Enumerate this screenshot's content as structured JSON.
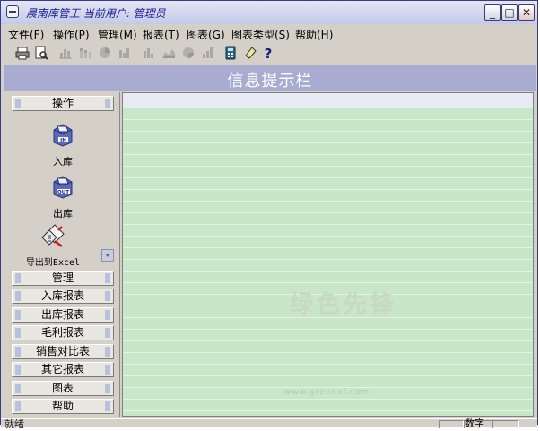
{
  "window": {
    "title": "晨南库管王  当前用户: 管理员",
    "minimize_glyph": "_",
    "maximize_glyph": "□",
    "close_glyph": "✕"
  },
  "menu": [
    "文件(F)",
    "操作(P)",
    "管理(M)",
    "报表(T)",
    "图表(G)",
    "图表类型(S)",
    "帮助(H)"
  ],
  "toolbar": {
    "icons": [
      "print-icon",
      "print-preview-icon",
      "bar-chart-icon",
      "stacked-chart-icon",
      "pie-chart-icon",
      "bar-chart-2-icon",
      "bar-chart-3-icon",
      "area-chart-icon",
      "pie-chart-2-icon",
      "bar-chart-4-icon",
      "calculator-icon",
      "eraser-icon",
      "help-icon"
    ]
  },
  "info_bar": {
    "label": "信息提示栏"
  },
  "left_panel": {
    "operations_header": "操作",
    "tools": [
      {
        "label": "入库",
        "icon": "stock-in-icon"
      },
      {
        "label": "出库",
        "icon": "stock-out-icon"
      },
      {
        "label": "导出到Excel",
        "icon": "export-excel-icon"
      }
    ],
    "sections": [
      "管理",
      "入库报表",
      "出库报表",
      "毛利报表",
      "销售对比表",
      "其它报表",
      "图表",
      "帮助"
    ]
  },
  "watermark": {
    "text": "绿色先锋",
    "url": "www.greenxf.com"
  },
  "status": {
    "text": "就绪",
    "num": "数字"
  }
}
